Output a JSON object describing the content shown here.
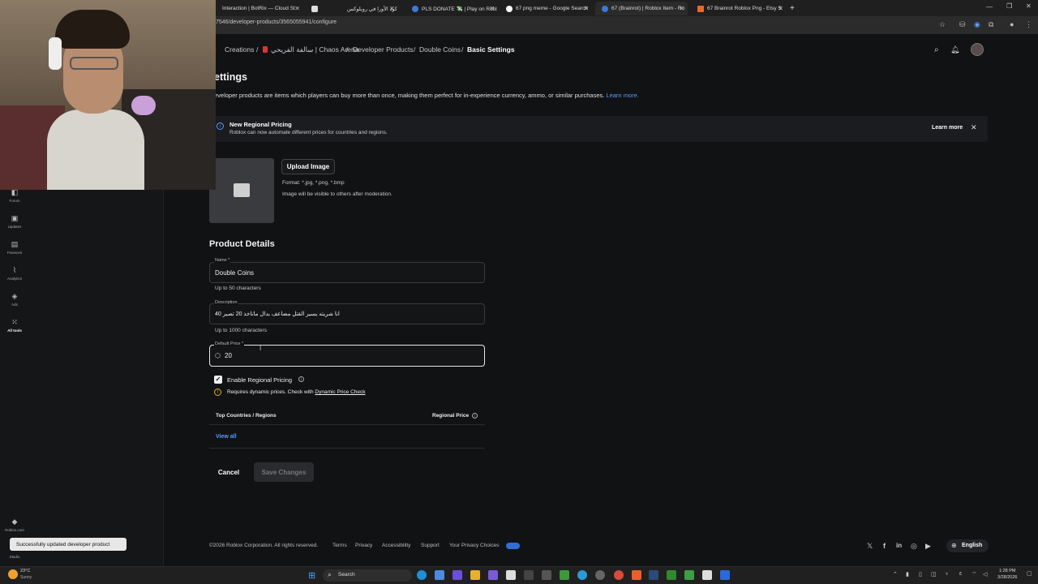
{
  "browser": {
    "tabs": [
      {
        "label": "Interaction | BotRix — Cloud St"
      },
      {
        "label": ""
      },
      {
        "label": "كود الأورا في روبلوكس"
      },
      {
        "label": "PLS DONATE 💸 | Play on Robl"
      },
      {
        "label": "67 png meme - Google Search"
      },
      {
        "label": "67 (Brainrot) | Roblox Item - Ro"
      },
      {
        "label": "67 Brainrot Roblox Png - Etsy S"
      }
    ],
    "url": "7546/developer-products/3565055941/configure"
  },
  "sidebar": {
    "items": [
      {
        "label": "Forum",
        "icon": "forum-icon"
      },
      {
        "label": "Updates",
        "icon": "updates-icon"
      },
      {
        "label": "Finances",
        "icon": "finances-icon"
      },
      {
        "label": "Analytics",
        "icon": "analytics-icon"
      },
      {
        "label": "Ads",
        "icon": "ads-icon"
      },
      {
        "label": "All tools",
        "icon": "grid-icon"
      }
    ],
    "roblox_label": "Roblox.com",
    "studio_label": "Studio"
  },
  "breadcrumb": {
    "items": [
      "Creations",
      "سالفة الفريحي | Chaos Arena",
      "Developer Products",
      "Double Coins"
    ],
    "current": "Basic Settings",
    "separator": "/"
  },
  "page": {
    "title": "ettings",
    "description": "eveloper products are items which players can buy more than once, making them perfect for in-experience currency, ammo, or similar purchases.",
    "learn_more": "Learn more."
  },
  "banner": {
    "title": "New Regional Pricing",
    "text": "Roblox can now automate different prices for countries and regions.",
    "learn_more": "Learn more"
  },
  "image_upload": {
    "button": "Upload Image",
    "format": "Format: *.jpg, *.png, *.bmp",
    "note": "Image will be visible to others after moderation."
  },
  "product_details": {
    "heading": "Product Details",
    "name_label": "Name *",
    "name_value": "Double Coins",
    "name_hint": "Up to 50 characters",
    "description_label": "Description",
    "description_value": "انا شريته يسير القتل مضاعف بدال ماتاخذ 20 تصير 40",
    "description_hint": "Up to 1000 characters",
    "price_label": "Default Price *",
    "price_value": "20",
    "robux_icon": "robux-icon"
  },
  "regional": {
    "enable_label": "Enable Regional Pricing",
    "checked": true,
    "warning": "Requires dynamic prices. Check with",
    "warning_link": "Dynamic Price Check",
    "col_countries": "Top Countries / Regions",
    "col_price": "Regional Price",
    "view_all": "View all"
  },
  "actions": {
    "cancel": "Cancel",
    "save": "Save Changes"
  },
  "footer": {
    "copyright": "©2026 Roblox Corporation. All rights reserved.",
    "links": [
      "Terms",
      "Privacy",
      "Accessibility",
      "Support",
      "Your Privacy Choices"
    ],
    "language": "English"
  },
  "toast": "Successfully updated developer product",
  "taskbar": {
    "weather_temp": "23°C",
    "weather_desc": "Sunny",
    "search": "Search",
    "time": "1:28 PM",
    "date": "3/28/2026",
    "lang": "ε"
  },
  "colors": {
    "accent_link": "#5a9cff",
    "background": "#111214",
    "focus_border": "#e6e6e6"
  }
}
